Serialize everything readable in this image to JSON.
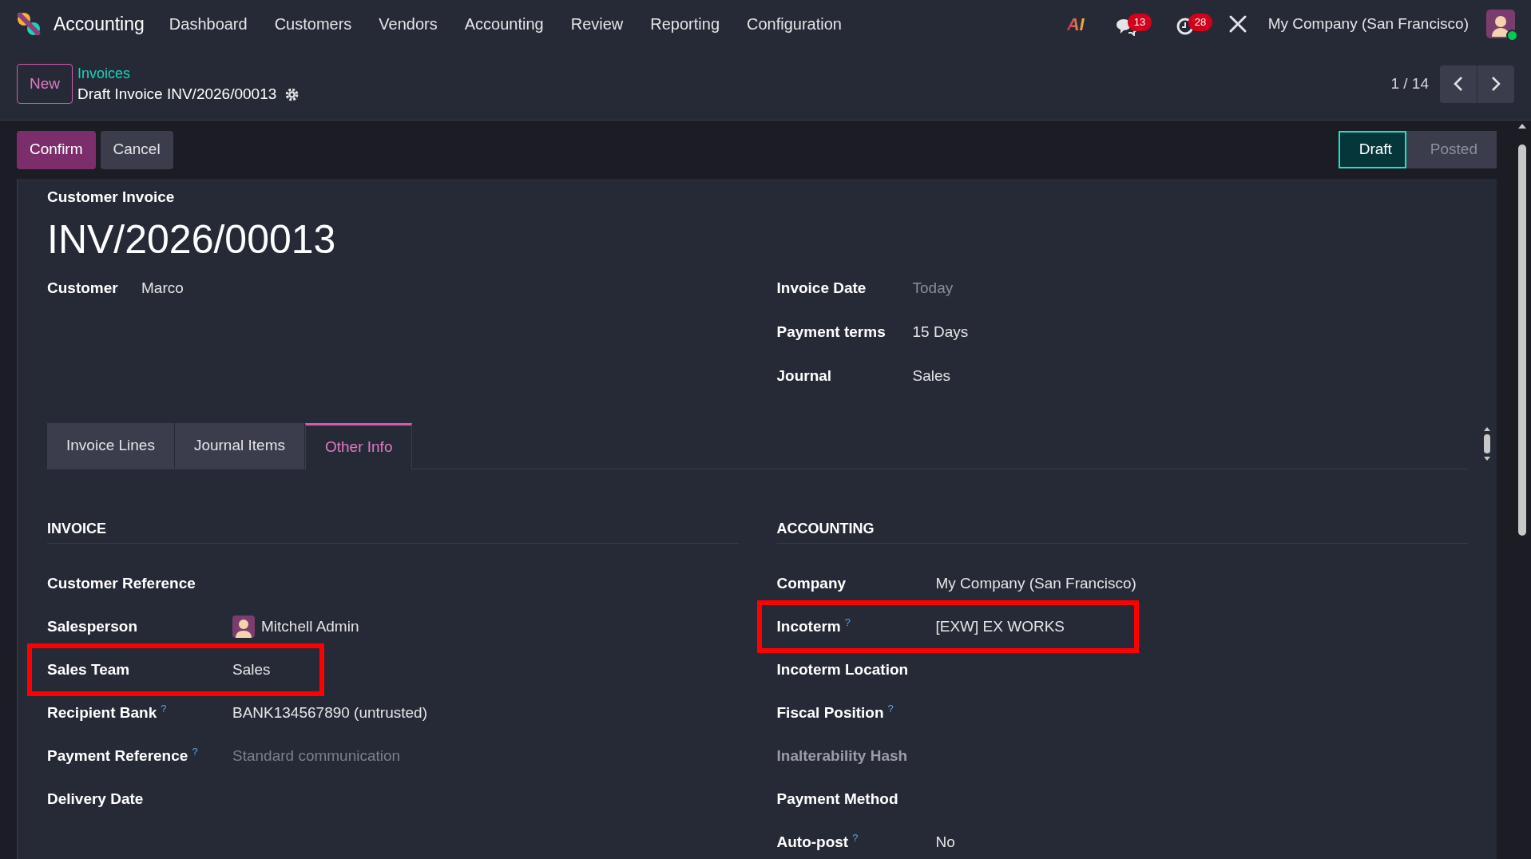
{
  "navbar": {
    "app": "Accounting",
    "menu": [
      "Dashboard",
      "Customers",
      "Vendors",
      "Accounting",
      "Review",
      "Reporting",
      "Configuration"
    ],
    "ai_logo": "AI",
    "messages_badge": "13",
    "activities_badge": "28",
    "company": "My Company (San Francisco)"
  },
  "control_panel": {
    "new_button": "New",
    "breadcrumb": "Invoices",
    "record": "Draft Invoice INV/2026/00013",
    "pager": "1 / 14"
  },
  "actions": [
    {
      "label": "Confirm",
      "kind": "primary"
    },
    {
      "label": "Cancel",
      "kind": "secondary"
    }
  ],
  "status_steps": [
    {
      "label": "Draft",
      "selected": true
    },
    {
      "label": "Posted",
      "selected": false
    }
  ],
  "sheet": {
    "type_label": "Customer Invoice",
    "name": "INV/2026/00013",
    "left_fields": [
      {
        "label": "Customer",
        "value": "Marco"
      }
    ],
    "right_fields": [
      {
        "label": "Invoice Date",
        "placeholder": "Today"
      },
      {
        "label": "Payment terms",
        "value": "15 Days"
      },
      {
        "label": "Journal",
        "value": "Sales"
      }
    ]
  },
  "tabs": [
    {
      "label": "Invoice Lines",
      "selected": false
    },
    {
      "label": "Journal Items",
      "selected": false
    },
    {
      "label": "Other Info",
      "selected": true
    }
  ],
  "sections": [
    {
      "title": "INVOICE",
      "fields": [
        {
          "label": "Customer Reference",
          "highlighted": false,
          "dimmed": false
        },
        {
          "label": "Salesperson",
          "value": "Mitchell Admin",
          "avatar": true,
          "highlighted": false,
          "dimmed": false
        },
        {
          "label": "Sales Team",
          "value": "Sales",
          "highlighted": true,
          "dimmed": false
        },
        {
          "label": "Recipient Bank",
          "hint": "?",
          "value": "BANK134567890 (untrusted)",
          "highlighted": false,
          "dimmed": false
        },
        {
          "label": "Payment Reference",
          "hint": "?",
          "placeholder": "Standard communication",
          "highlighted": false,
          "dimmed": false
        },
        {
          "label": "Delivery Date",
          "highlighted": false,
          "dimmed": false
        }
      ]
    },
    {
      "title": "ACCOUNTING",
      "fields": [
        {
          "label": "Company",
          "value": "My Company (San Francisco)",
          "highlighted": false,
          "dimmed": false
        },
        {
          "label": "Incoterm",
          "hint": "?",
          "value": "[EXW] EX WORKS",
          "highlighted": true,
          "dimmed": false
        },
        {
          "label": "Incoterm Location",
          "highlighted": false,
          "dimmed": false
        },
        {
          "label": "Fiscal Position",
          "hint": "?",
          "highlighted": false,
          "dimmed": false
        },
        {
          "label": "Inalterability Hash",
          "highlighted": false,
          "dimmed": true
        },
        {
          "label": "Payment Method",
          "highlighted": false,
          "dimmed": false
        },
        {
          "label": "Auto-post",
          "hint": "?",
          "value": "No",
          "highlighted": false,
          "dimmed": false
        }
      ]
    }
  ]
}
